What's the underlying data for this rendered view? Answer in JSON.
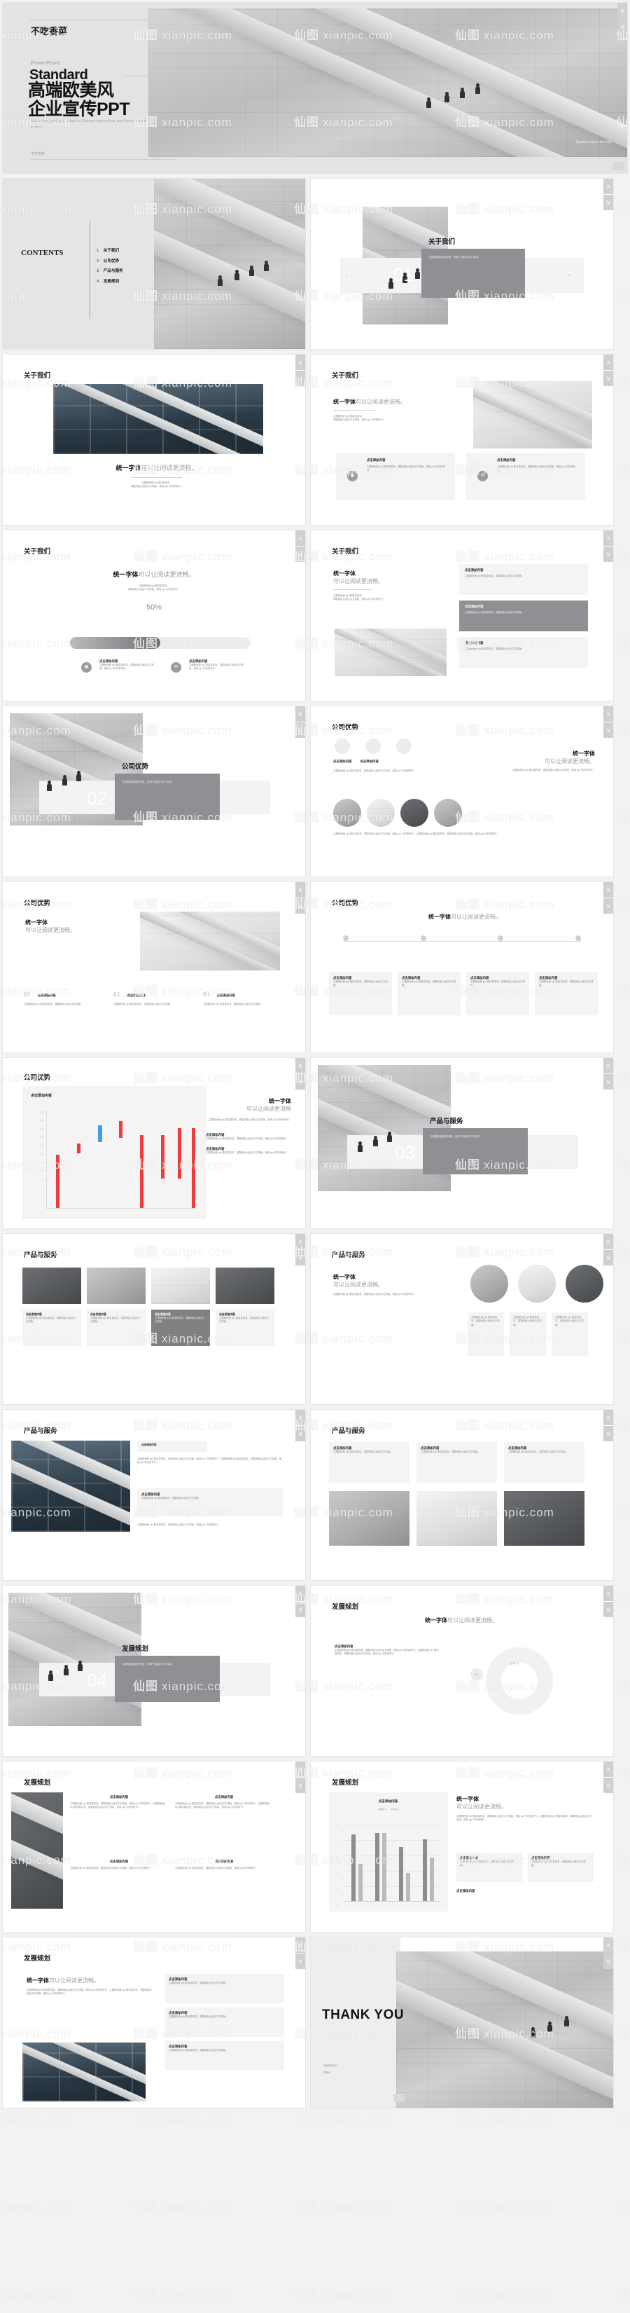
{
  "meta": {
    "watermark_text": "xianpic.com",
    "watermark_logo": "仙图",
    "accent_grey": "#8e9093",
    "accent_light": "#f3f3f3",
    "accent_red": "#ef3b3b",
    "accent_blue": "#3f9fe0",
    "nav_up": "∧",
    "nav_down": "∨",
    "prev": "‹",
    "next": "›",
    "grid_icon": "∷"
  },
  "hero": {
    "brand": "不吃香菜",
    "eyebrow": "PowerPoint",
    "latin_title": "Standard",
    "title_line1": "高端欧美风",
    "title_line2": "企业宣传PPT",
    "subtitle": "Adjust the spacing to adapt to Chinese typesetting, use the reference line in PPT.",
    "signature": "不吃香菜",
    "speaker": "Speaker name and title"
  },
  "contents": {
    "label": "CONTENTS",
    "items": [
      {
        "num": "1.",
        "label": "关于我们"
      },
      {
        "num": "2.",
        "label": "公司优势"
      },
      {
        "num": "3.",
        "label": "产品与服务"
      },
      {
        "num": "4.",
        "label": "发展规划"
      }
    ]
  },
  "sections": [
    {
      "num": "01",
      "title": "关于我们",
      "desc": "当您复制粘贴的时候，选择“只保存文本”选项。"
    },
    {
      "num": "02",
      "title": "公司优势",
      "desc": "当您复制粘贴的时候，选择“只保存文本”选项。"
    },
    {
      "num": "03",
      "title": "产品与服务",
      "desc": "当您复制粘贴的时候，选择“只保存文本”选项。"
    },
    {
      "num": "04",
      "title": "发展规划",
      "desc": "当您复制粘贴的时候，选择“只保存文本”选项。"
    }
  ],
  "headings": {
    "about": "关于我们",
    "advantage": "公司优势",
    "product": "产品与服务",
    "plan": "发展规划"
  },
  "common": {
    "tagline_bold": "统一字体",
    "tagline_rest": "可以让阅读更流畅。",
    "tagline_rest_nodot": "可以让阅读更流畅",
    "sub1": "主题颜色使 ppt 更容易改变。",
    "sub2": "调整间距以适应中文排版，使用 ppt 中的参考行。",
    "body_long": "主题颜色使 ppt 更容易改变。调整间距以适应中文排版，使用 ppt 中的参考行。主题颜色使 ppt 更容易改变，调整间距以适应中文排版，使用 ppt 中的参考行。",
    "body_mid": "主题颜色使 ppt 更容易改变，调整间距以适应中文排版，使用 ppt 中的参考行。",
    "click_add": "点击添加内容",
    "click_add_dot": "点击添加内容.",
    "percent": "50%",
    "signature": "Signature",
    "date": "Date",
    "thanks": "THANK YOU"
  },
  "chart_data": [
    {
      "id": "advantage-bars",
      "type": "bar",
      "title": "点击添加内容.",
      "xlabel": "",
      "ylabel": "",
      "ylim": [
        0,
        180
      ],
      "yticks": [
        0,
        20,
        40,
        60,
        80,
        100,
        120,
        140,
        160,
        180
      ],
      "grid": false,
      "legend": "none",
      "categories": [
        "1",
        "2",
        "3",
        "4",
        "5",
        "6",
        "7",
        "8"
      ],
      "series": [
        {
          "name": "指标 1",
          "color": "#ef3b3b",
          "values": [
            98,
            118,
            0,
            152,
            132,
            130,
            145,
            145
          ]
        },
        {
          "name": "指标 2",
          "color": "#3f9fe0",
          "values": [
            0,
            0,
            150,
            0,
            0,
            0,
            0,
            0
          ]
        }
      ],
      "bar_bases": [
        0,
        100,
        120,
        128,
        0,
        55,
        55,
        0
      ]
    },
    {
      "id": "plan-bars",
      "type": "bar",
      "title": "点击添加内容.",
      "legend": "top",
      "legend_entries": [
        "指标 1",
        "指标 2"
      ],
      "xlabel": "",
      "ylabel": "",
      "ylim": [
        0,
        5
      ],
      "yticks": [
        0,
        1,
        2,
        3,
        4,
        5
      ],
      "grid": true,
      "categories": [
        "类别 1",
        "类别 2",
        "类别 3",
        "类别 4"
      ],
      "series": [
        {
          "name": "指标 1",
          "color": "#8b8d8f",
          "values": [
            4.3,
            4.4,
            3.5,
            4.0
          ]
        },
        {
          "name": "指标 2",
          "color": "#b9bbbd",
          "values": [
            2.4,
            4.4,
            1.8,
            2.8
          ]
        }
      ]
    },
    {
      "id": "plan-donut",
      "type": "pie",
      "title": "点击添加内容",
      "labels": [
        "01",
        "02",
        "03"
      ],
      "values": [
        40,
        35,
        25
      ],
      "colors": [
        "#d8d9da",
        "#ededee",
        "#c3c4c5"
      ]
    }
  ],
  "cards": {
    "two_up": [
      {
        "title": "点击添加内容",
        "body": "主题颜色使 ppt 更容易改变。调整间距以适应中文排版，使用 ppt 中的参考行。"
      },
      {
        "title": "点击添加内容",
        "body": "主题颜色使 ppt 更容易改变。调整间距以适应中文排版，使用 ppt 中的参考行。"
      }
    ],
    "three_up": [
      {
        "num": "01",
        "title": "点击添加内容",
        "body": "主题颜色使 ppt 更容易改变，调整间距以适应中文排版。"
      },
      {
        "num": "02",
        "title": "点击添加内容",
        "body": "主题颜色使 ppt 更容易改变，调整间距以适应中文排版。"
      },
      {
        "num": "03",
        "title": "点击添加内容",
        "body": "主题颜色使 ppt 更容易改变，调整间距以适应中文排版。"
      }
    ],
    "four_up": [
      {
        "title": "点击添加内容",
        "body": "主题颜色使 ppt 更容易改变，调整间距以适应中文排版。"
      },
      {
        "title": "点击添加内容",
        "body": "主题颜色使 ppt 更容易改变，调整间距以适应中文排版。"
      },
      {
        "title": "点击添加内容",
        "body": "主题颜色使 ppt 更容易改变，调整间距以适应中文排版。"
      },
      {
        "title": "点击添加内容",
        "body": "主题颜色使 ppt 更容易改变，调整间距以适应中文排版。"
      }
    ]
  }
}
